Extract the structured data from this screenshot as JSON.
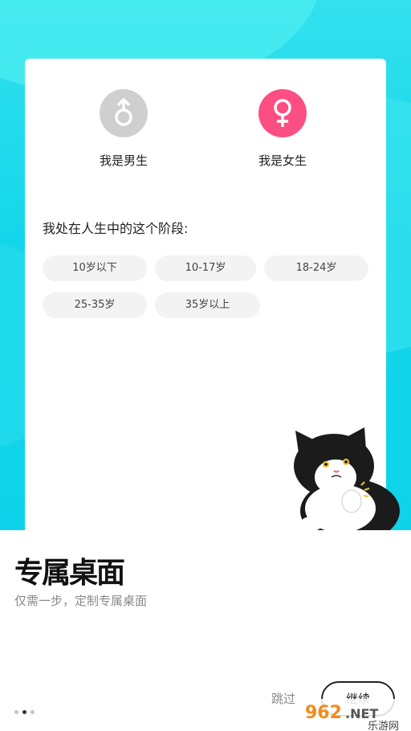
{
  "gender": {
    "male_label": "我是男生",
    "female_label": "我是女生",
    "male_color": "#cfcfcf",
    "female_color": "#fb4f84"
  },
  "stage": {
    "title": "我处在人生中的这个阶段:",
    "options": [
      "10岁以下",
      "10-17岁",
      "18-24岁",
      "25-35岁",
      "35岁以上"
    ]
  },
  "bottom": {
    "title": "专属桌面",
    "subtitle": "仅需一步，定制专属桌面",
    "skip_label": "跳过",
    "continue_label": "继续"
  },
  "pager": {
    "count": 3,
    "active": 2
  },
  "watermark": {
    "text": "962.NET",
    "subtext": "乐游网"
  }
}
